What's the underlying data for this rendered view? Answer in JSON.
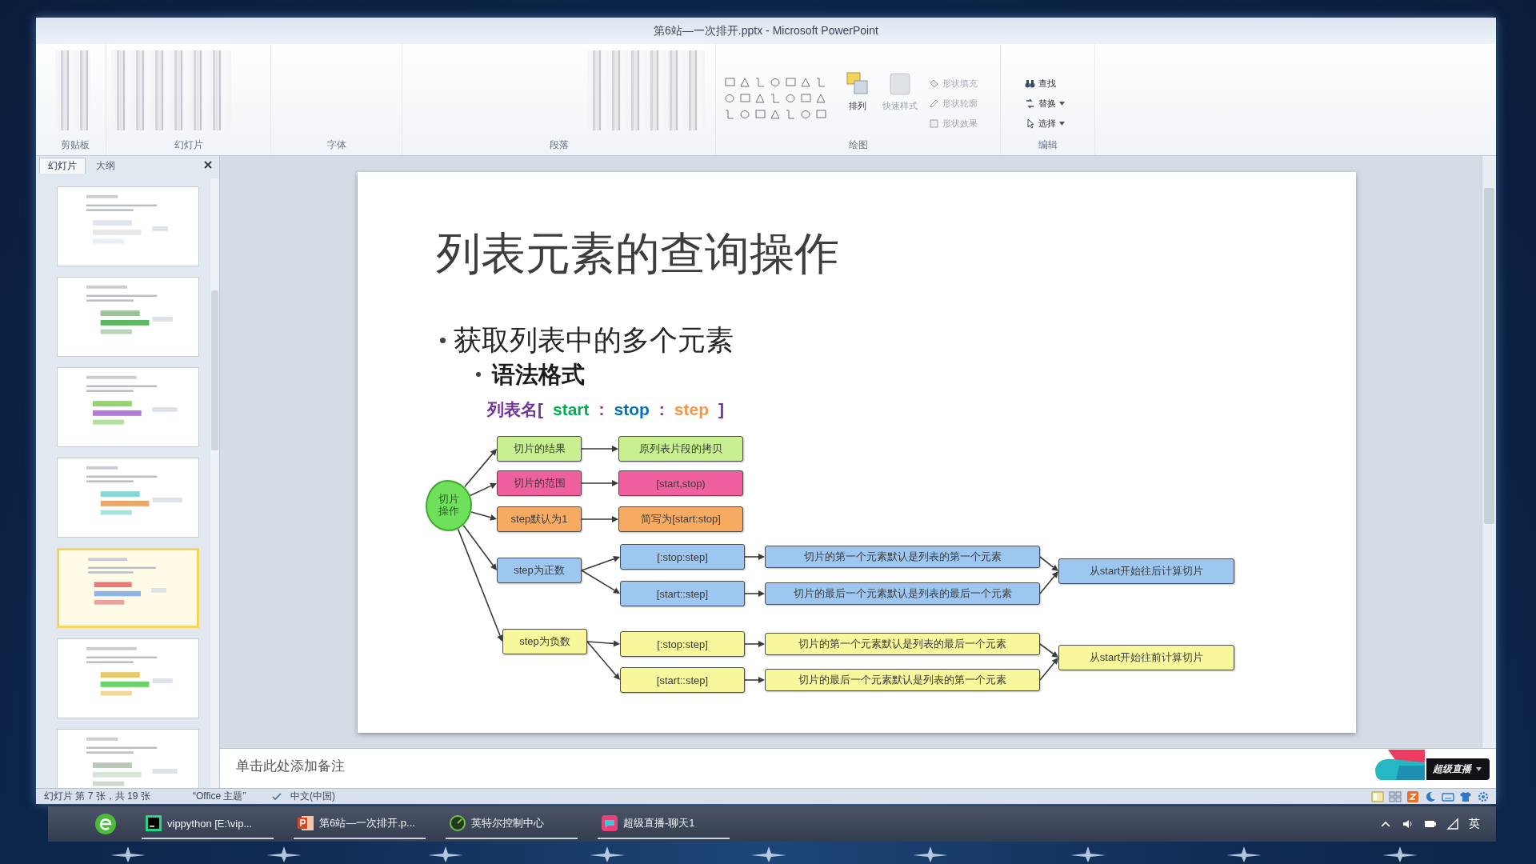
{
  "window": {
    "title": "第6站—一次排开.pptx - Microsoft PowerPoint"
  },
  "ribbon": {
    "groups": [
      {
        "label": "剪贴板"
      },
      {
        "label": "幻灯片"
      },
      {
        "label": "字体"
      },
      {
        "label": "段落"
      },
      {
        "label": "绘图"
      },
      {
        "label": "编辑"
      }
    ],
    "large_buttons": [
      {
        "label": "排列",
        "disabled": false
      },
      {
        "label": "快速样式",
        "disabled": true
      }
    ],
    "shape_format": [
      {
        "label": "形状填充",
        "disabled": true
      },
      {
        "label": "形状轮廓",
        "disabled": true
      },
      {
        "label": "形状效果",
        "disabled": true
      }
    ],
    "editing": [
      {
        "label": "查找"
      },
      {
        "label": "替换"
      },
      {
        "label": "选择"
      }
    ]
  },
  "slide_panel": {
    "tabs": [
      {
        "label": "幻灯片",
        "selected": true
      },
      {
        "label": "大纲",
        "selected": false
      }
    ],
    "thumbnails": [
      {
        "selected": false
      },
      {
        "selected": false
      },
      {
        "selected": false
      },
      {
        "selected": false
      },
      {
        "selected": true
      },
      {
        "selected": false
      },
      {
        "selected": false
      }
    ]
  },
  "slide": {
    "title": "列表元素的查询操作",
    "bullets": [
      {
        "text": "获取列表中的多个元素",
        "children": [
          {
            "text": "语法格式"
          }
        ]
      }
    ],
    "syntax": [
      {
        "text": "列表名[",
        "color": "#7030a0"
      },
      {
        "text": "start",
        "color": "#00b050"
      },
      {
        "text": ":",
        "color": "#7030a0"
      },
      {
        "text": "stop",
        "color": "#0070c0"
      },
      {
        "text": ":",
        "color": "#7030a0"
      },
      {
        "text": "step",
        "color": "#f79646"
      },
      {
        "text": "]",
        "color": "#7030a0"
      }
    ],
    "diagram": {
      "root": {
        "label": "切片操作",
        "color": "#6ee05a"
      },
      "branches": [
        {
          "kind": "simple",
          "label": "切片的结果",
          "result": "原列表片段的拷贝",
          "color": "#c8f090"
        },
        {
          "kind": "simple",
          "label": "切片的范围",
          "result": "[start,stop)",
          "color": "#f0609e"
        },
        {
          "kind": "simple",
          "label": "step默认为1",
          "result": "简写为[start:stop]",
          "color": "#f7ab62"
        },
        {
          "kind": "split",
          "label": "step为正数",
          "color": "#9dc6f0",
          "forms": [
            {
              "syntax": "[:stop:step]",
              "note": "切片的第一个元素默认是列表的第一个元素"
            },
            {
              "syntax": "[start::step]",
              "note": "切片的最后一个元素默认是列表的最后一个元素"
            }
          ],
          "summary": "从start开始往后计算切片"
        },
        {
          "kind": "split",
          "label": "step为负数",
          "color": "#f7f79c",
          "forms": [
            {
              "syntax": "[:stop:step]",
              "note": "切片的第一个元素默认是列表的最后一个元素"
            },
            {
              "syntax": "[start::step]",
              "note": "切片的最后一个元素默认是列表的第一个元素"
            }
          ],
          "summary": "从start开始往前计算切片"
        }
      ]
    }
  },
  "notes": {
    "placeholder": "单击此处添加备注"
  },
  "floating_widget": {
    "label": "超级直播"
  },
  "status_bar": {
    "slide_info": "幻灯片 第 7 张，共 19 张",
    "theme": "“Office 主题”",
    "language": "中文(中国)"
  },
  "taskbar": {
    "items": [
      {
        "label": "vippython [E:\\vip...",
        "kind": "editor"
      },
      {
        "label": "第6站—一次排开.p...",
        "kind": "presentation"
      },
      {
        "label": "英特尔控制中心",
        "kind": "control"
      },
      {
        "label": "超级直播-聊天1",
        "kind": "chat"
      }
    ],
    "input_indicator": "英"
  }
}
